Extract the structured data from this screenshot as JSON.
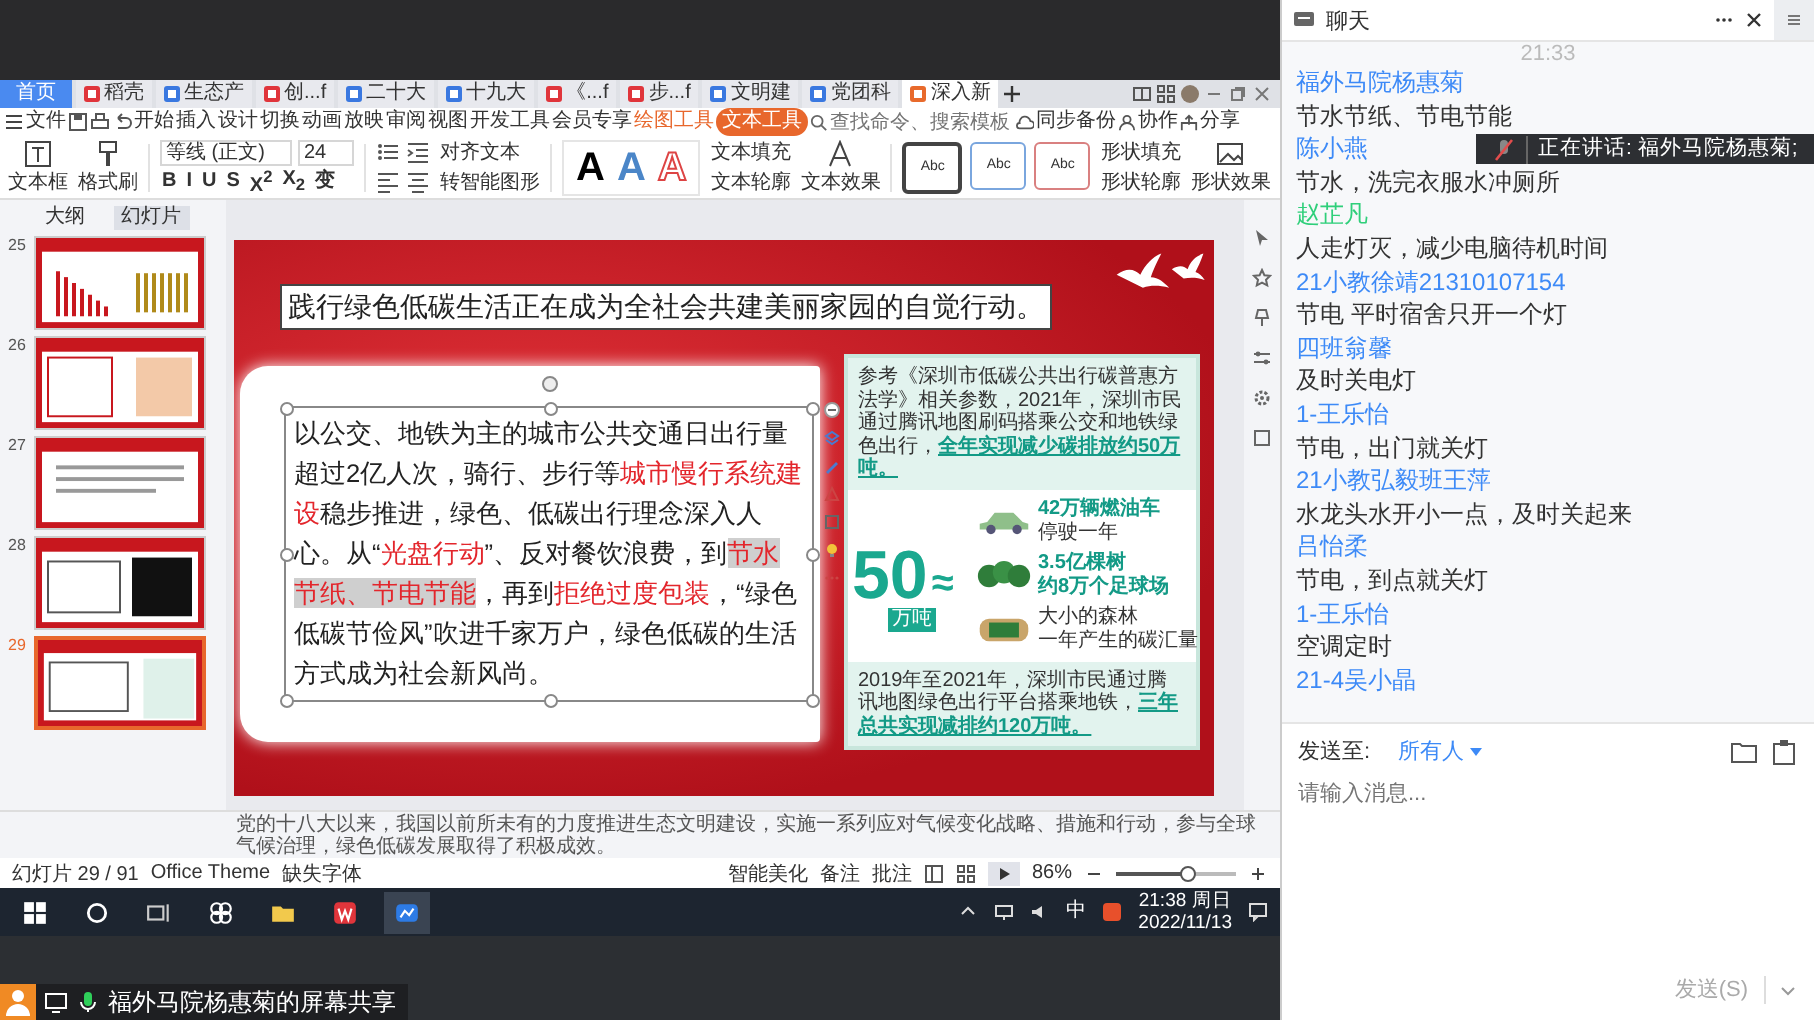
{
  "wps": {
    "doc_tabs": [
      {
        "label": "首页",
        "kind": "home",
        "selected": false
      },
      {
        "label": "稻壳",
        "kind": "docer",
        "selected": false
      },
      {
        "label": "生态产",
        "kind": "doc",
        "selected": false
      },
      {
        "label": "创...f",
        "kind": "pdf",
        "selected": false
      },
      {
        "label": "二十大",
        "kind": "doc",
        "selected": false
      },
      {
        "label": "十九大",
        "kind": "doc",
        "selected": false
      },
      {
        "label": "《...f",
        "kind": "pdf",
        "selected": false
      },
      {
        "label": "步...f",
        "kind": "pdf",
        "selected": false
      },
      {
        "label": "文明建",
        "kind": "doc",
        "selected": false
      },
      {
        "label": "党团科",
        "kind": "doc",
        "selected": false
      },
      {
        "label": "深入新",
        "kind": "ppt",
        "selected": true
      }
    ],
    "file_menu": "文件",
    "ribbon_tabs": [
      {
        "label": "开始",
        "kind": "tab",
        "selected": false
      },
      {
        "label": "插入",
        "kind": "tab",
        "selected": false
      },
      {
        "label": "设计",
        "kind": "tab",
        "selected": false
      },
      {
        "label": "切换",
        "kind": "tab",
        "selected": false
      },
      {
        "label": "动画",
        "kind": "tab",
        "selected": false
      },
      {
        "label": "放映",
        "kind": "tab",
        "selected": false
      },
      {
        "label": "审阅",
        "kind": "tab",
        "selected": false
      },
      {
        "label": "视图",
        "kind": "tab",
        "selected": false
      },
      {
        "label": "开发工具",
        "kind": "tab",
        "selected": false
      },
      {
        "label": "会员专享",
        "kind": "tab",
        "selected": false
      },
      {
        "label": "绘图工具",
        "kind": "context",
        "selected": false
      },
      {
        "label": "文本工具",
        "kind": "context",
        "selected": true
      }
    ],
    "search": {
      "placeholder": "查找命令、搜索模板"
    },
    "ribbon_actions": [
      {
        "label": "同步备份",
        "kind": "cloud"
      },
      {
        "label": "协作",
        "kind": "people"
      },
      {
        "label": "分享",
        "kind": "share"
      }
    ],
    "toolbar": {
      "textbox": "文本框",
      "format_painter": "格式刷",
      "font": "等线 (正文)",
      "font_size": "24",
      "format_marks": [
        "B",
        "I",
        "U",
        "S",
        "X$^{2}$",
        "X$_{2}$",
        "变"
      ],
      "align_text": "对齐文本",
      "smart_art": "转智能图形",
      "art_styles": [
        {
          "letter": "A",
          "kind": "solid"
        },
        {
          "letter": "A",
          "kind": "blue"
        },
        {
          "letter": "A",
          "kind": "outline"
        }
      ],
      "text_actions": [
        "文本填充",
        "文本轮廓"
      ],
      "text_effect": "文本效果",
      "shape_styles": [
        {
          "label": "Abc",
          "kind": "gray",
          "selected": true
        },
        {
          "label": "Abc",
          "kind": "blue",
          "selected": false
        },
        {
          "label": "Abc",
          "kind": "red",
          "selected": false
        }
      ],
      "shape_actions": [
        "形状填充",
        "形状轮廓"
      ],
      "shape_effect": "形状效果"
    }
  },
  "slides_panel": {
    "tabs": [
      {
        "label": "大纲",
        "selected": false
      },
      {
        "label": "幻灯片",
        "selected": true
      }
    ],
    "thumbnails": [
      {
        "number": "25",
        "kind": "chart",
        "selected": false
      },
      {
        "number": "26",
        "kind": "panels",
        "selected": false
      },
      {
        "number": "27",
        "kind": "text",
        "selected": false
      },
      {
        "number": "28",
        "kind": "image",
        "selected": false
      },
      {
        "number": "29",
        "kind": "current",
        "selected": true
      }
    ]
  },
  "slide": {
    "title": "践行绿色低碳生活正在成为全社会共建美丽家园的自觉行动。",
    "paragraph": [
      {
        "text": "以公交、地铁为主的城市公共交通日出行量超过2亿人次，骑行、步行等",
        "kind": "plain"
      },
      {
        "text": "城市慢行系统建设",
        "kind": "red"
      },
      {
        "text": "稳步推进，绿色、低碳出行理念深入人心。从“",
        "kind": "plain"
      },
      {
        "text": "光盘行动",
        "kind": "red"
      },
      {
        "text": "”、反对餐饮浪费，到",
        "kind": "plain"
      },
      {
        "text": "节水节纸、节电节能",
        "kind": "marked"
      },
      {
        "text": "，再到",
        "kind": "plain"
      },
      {
        "text": "拒绝过度包装",
        "kind": "red"
      },
      {
        "text": "，“绿色低碳节俭风”吹进千家万户，绿色低碳的生活方式成为社会新风尚。",
        "kind": "plain"
      }
    ],
    "infographic": {
      "intro": [
        {
          "text": "参考《深圳市低碳公共出行碳普惠方法学》相关参数，2021年，深圳市民通过腾讯地图刷码搭乘公交和地铁绿色出行，",
          "kind": "plain"
        },
        {
          "text": "全年实现减少碳排放约50万吨。",
          "kind": "link"
        }
      ],
      "big_number": "50",
      "unit": "万吨",
      "approx": "≈",
      "equivalents": [
        {
          "kind": "car",
          "lines": [
            {
              "text": "42万辆燃油车",
              "kind": "accent"
            },
            {
              "text": "停驶一年",
              "kind": "plain"
            }
          ]
        },
        {
          "kind": "trees",
          "lines": [
            {
              "text": "3.5亿棵树",
              "kind": "accent"
            },
            {
              "text": "约8万个足球场",
              "kind": "accent"
            }
          ]
        },
        {
          "kind": "field",
          "lines": [
            {
              "text": "大小的森林",
              "kind": "plain"
            },
            {
              "text": "一年产生的碳汇量",
              "kind": "plain"
            }
          ]
        }
      ],
      "outro": [
        {
          "text": "2019年至2021年，深圳市民通过腾讯地图绿色出行平台搭乘地铁，",
          "kind": "plain"
        },
        {
          "text": "三年总共实现减排约120万吨。",
          "kind": "link"
        }
      ]
    }
  },
  "notes": "党的十八大以来，我国以前所未有的力度推进生态文明建设，实施一系列应对气候变化战略、措施和行动，参与全球气候治理，绿色低碳发展取得了积极成效。",
  "status_bar": {
    "slide_counter": "幻灯片 29 / 91",
    "theme": "Office Theme",
    "missing_fonts": "缺失字体",
    "beautify": "智能美化",
    "notes": "备注",
    "comments": "批注",
    "zoom": "86%",
    "zoom_slider": {
      "level": 0.6
    }
  },
  "taskbar": {
    "ime": "中",
    "time": "21:38 周日",
    "date": "2022/11/13"
  },
  "screen_share": {
    "label": "福外马院杨惠菊的屏幕共享"
  },
  "chat": {
    "title": "聊天",
    "time": "21:33",
    "messages": [
      {
        "sender": "福外马院杨惠菊",
        "color": "#3d8af7",
        "text": "节水节纸、节电节能"
      },
      {
        "sender": "陈小燕",
        "color": "#3d8af7",
        "text": "节水，洗完衣服水冲厕所"
      },
      {
        "sender": "赵芷凡",
        "color": "#2fcf7a",
        "text": "人走灯灭，减少电脑待机时间"
      },
      {
        "sender": "21小教徐靖21310107154",
        "color": "#3d8af7",
        "text": "节电 平时宿舍只开一个灯"
      },
      {
        "sender": "四班翁馨",
        "color": "#3d8af7",
        "text": "及时关电灯"
      },
      {
        "sender": "1-王乐怡",
        "color": "#3d8af7",
        "text": "节电，出门就关灯"
      },
      {
        "sender": "21小教弘毅班王萍",
        "color": "#3d8af7",
        "text": "水龙头水开小一点，及时关起来"
      },
      {
        "sender": "吕怡柔",
        "color": "#3d8af7",
        "text": "节电，到点就关灯"
      },
      {
        "sender": "1-王乐怡",
        "color": "#3d8af7",
        "text": "空调定时"
      },
      {
        "sender": "21-4吴小晶",
        "color": "#3d8af7"
      }
    ],
    "speaking": {
      "label": "正在讲话: 福外马院杨惠菊;"
    },
    "send_to_label": "发送至:",
    "recipient": "所有人",
    "input": {
      "placeholder": "请输入消息..."
    },
    "send_button": "发送(S)"
  }
}
